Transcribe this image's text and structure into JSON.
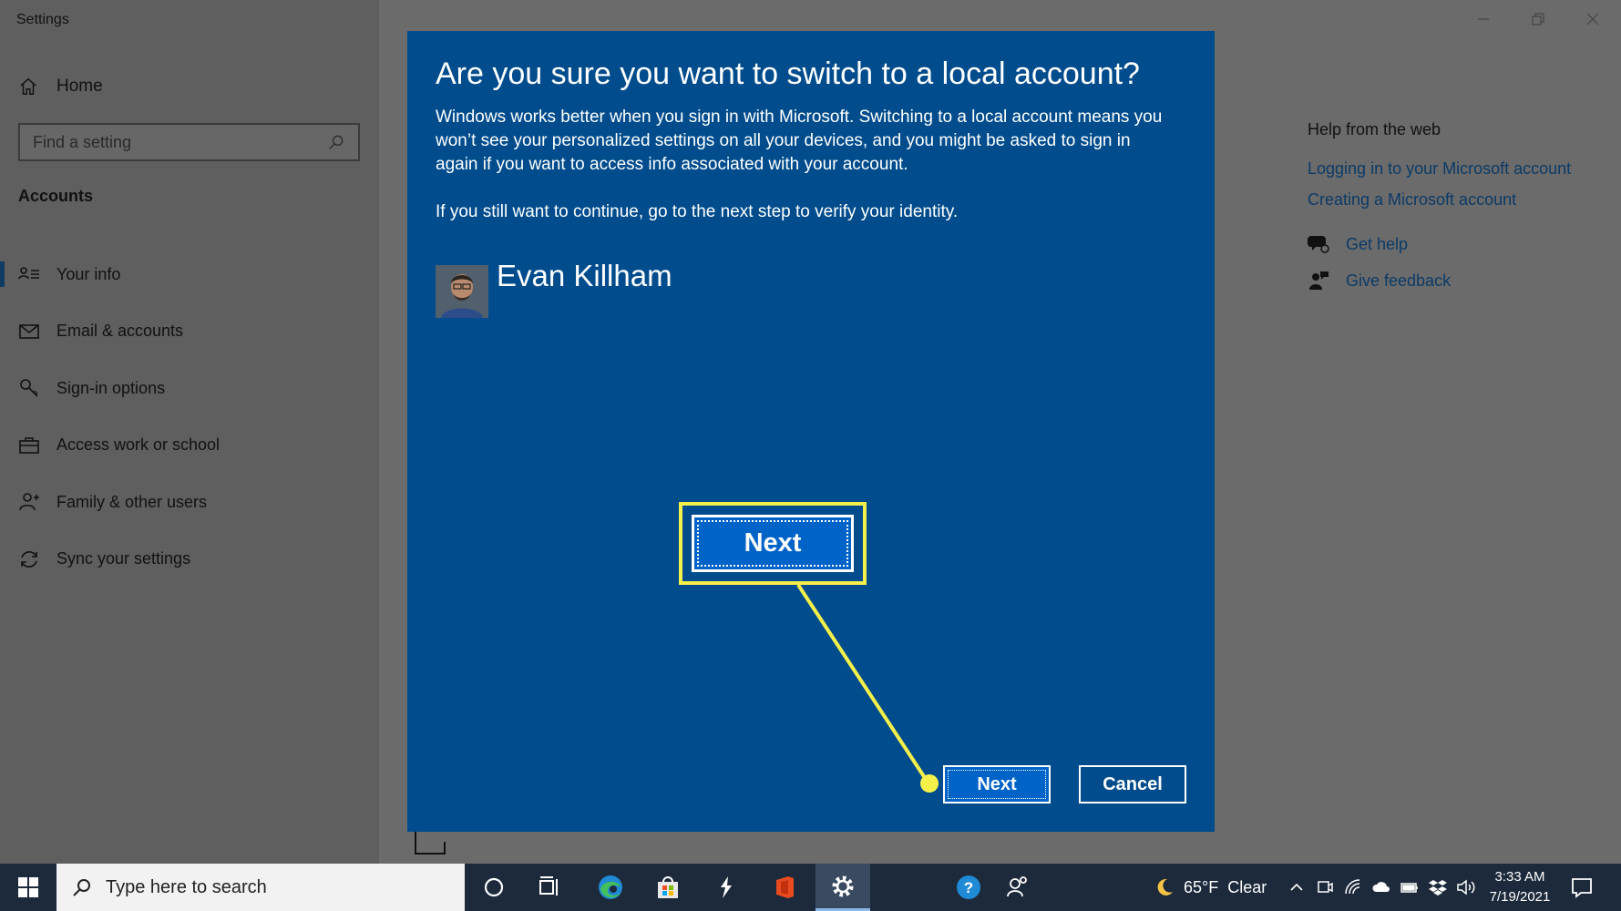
{
  "window": {
    "title": "Settings",
    "home_label": "Home",
    "search_placeholder": "Find a setting",
    "section_title": "Accounts",
    "nav_items": [
      {
        "label": "Your info"
      },
      {
        "label": "Email & accounts"
      },
      {
        "label": "Sign-in options"
      },
      {
        "label": "Access work or school"
      },
      {
        "label": "Family & other users"
      },
      {
        "label": "Sync your settings"
      }
    ],
    "active_nav_index": 0
  },
  "help": {
    "title": "Help from the web",
    "links": [
      "Logging in to your Microsoft account",
      "Creating a Microsoft account"
    ],
    "get_help": "Get help",
    "give_feedback": "Give feedback"
  },
  "dialog": {
    "title": "Are you sure you want to switch to a local account?",
    "body": "Windows works better when you sign in with Microsoft. Switching to a local account means you won’t see your personalized settings on all your devices, and you might be asked to sign in again if you want to access info associated with your account.",
    "body2": "If you still want to continue, go to the next step to verify your identity.",
    "user_name": "Evan Killham",
    "next_label": "Next",
    "cancel_label": "Cancel"
  },
  "callout": {
    "label": "Next",
    "color": "#f6f04a"
  },
  "taskbar": {
    "search_placeholder": "Type here to search",
    "weather": "65°F  Clear",
    "time": "3:33 AM",
    "date": "7/19/2021"
  },
  "colors": {
    "dialog_bg": "#004c8c",
    "button_bg": "#0063c8",
    "link": "#0b3a66",
    "taskbar": "#1c2a3c"
  }
}
